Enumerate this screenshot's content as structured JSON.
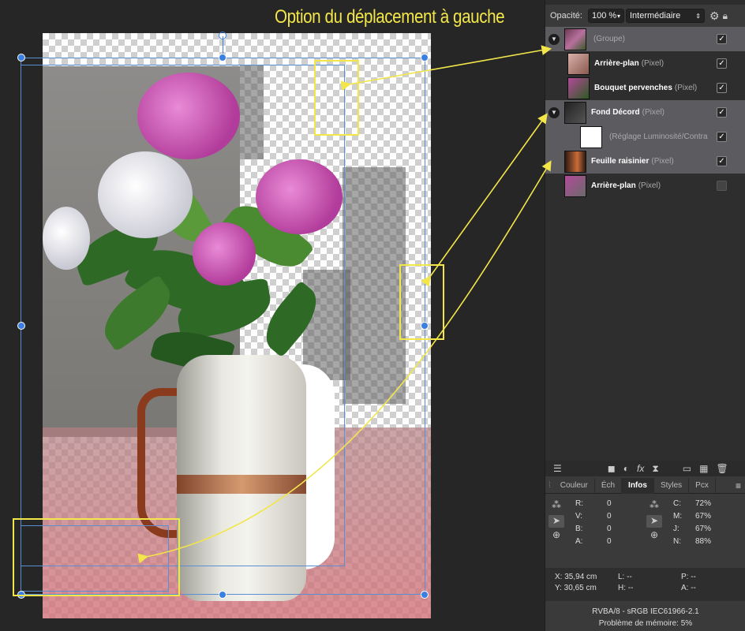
{
  "annotation_title": "Option du déplacement à gauche",
  "layers_panel": {
    "opacity_label": "Opacité:",
    "opacity_value": "100 %",
    "blend_mode": "Intermédiaire",
    "layers": [
      {
        "name": "",
        "type": "(Groupe)",
        "checked": true,
        "selected": true,
        "twisty": true,
        "indent": 0
      },
      {
        "name": "Arrière-plan",
        "type": "(Pixel)",
        "checked": true,
        "selected": false,
        "twisty": false,
        "indent": 1
      },
      {
        "name": "Bouquet pervenches",
        "type": "(Pixel)",
        "checked": true,
        "selected": false,
        "twisty": false,
        "indent": 1
      },
      {
        "name": "Fond Décord",
        "type": "(Pixel)",
        "checked": true,
        "selected": true,
        "twisty": true,
        "indent": 0
      },
      {
        "name": "",
        "type": "(Réglage Luminosité/Contra",
        "checked": true,
        "selected": true,
        "twisty": false,
        "indent": 2
      },
      {
        "name": "Feuille raisinier",
        "type": "(Pixel)",
        "checked": true,
        "selected": true,
        "twisty": false,
        "indent": 0
      },
      {
        "name": "Arrière-plan",
        "type": "(Pixel)",
        "checked": false,
        "selected": false,
        "twisty": false,
        "indent": 0
      }
    ]
  },
  "tabs": [
    "Couleur",
    "Éch",
    "Infos",
    "Styles",
    "Pcx"
  ],
  "active_tab": "Infos",
  "info": {
    "rgb": [
      {
        "label": "R:",
        "value": "0"
      },
      {
        "label": "V:",
        "value": "0"
      },
      {
        "label": "B:",
        "value": "0"
      },
      {
        "label": "A:",
        "value": "0"
      }
    ],
    "cmyk": [
      {
        "label": "C:",
        "value": "72%"
      },
      {
        "label": "M:",
        "value": "67%"
      },
      {
        "label": "J:",
        "value": "67%"
      },
      {
        "label": "N:",
        "value": "88%"
      }
    ],
    "x": "X: 35,94 cm",
    "y": "Y: 30,65 cm",
    "l": "L: --",
    "h": "H: --",
    "p": "P: --",
    "a": "A: --"
  },
  "status": {
    "format": "RVBA/8 - sRGB IEC61966-2.1",
    "memory": "Problème de mémoire: 5%"
  },
  "colors": {
    "accent": "#f2e649",
    "selection": "#3b7fe0"
  }
}
